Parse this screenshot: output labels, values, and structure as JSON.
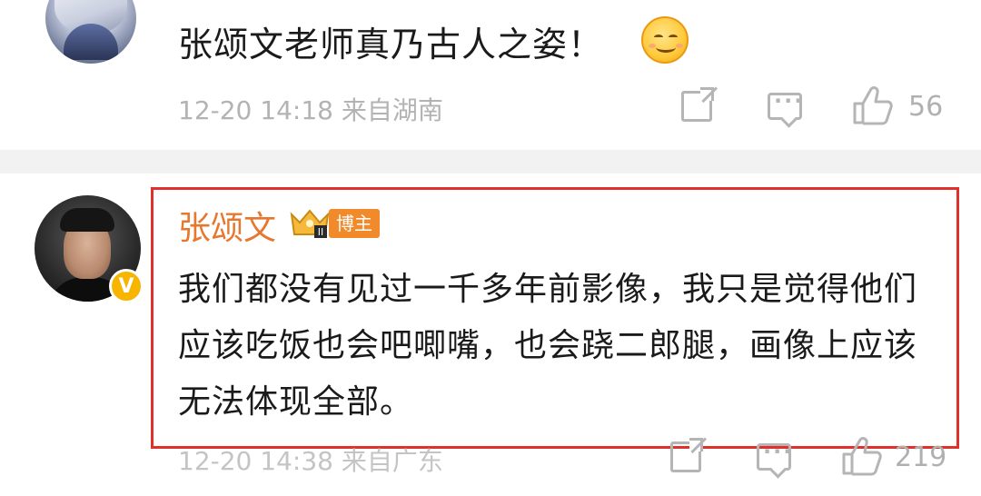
{
  "comment1": {
    "text": "张颂文老师真乃古人之姿！",
    "emoji": "smiley-emoji",
    "meta": "12-20 14:18 来自湖南",
    "likes": "56"
  },
  "comment2": {
    "username": "张颂文",
    "badge": "博主",
    "verified_badge": "V",
    "text": "我们都没有见过一千多年前影像，我只是觉得他们应该吃饭也会吧唧嘴，也会跷二郎腿，画像上应该无法体现全部。",
    "meta": "12-20 14:38 来自广东",
    "likes": "219"
  },
  "colors": {
    "username": "#e8772e",
    "highlight_border": "#e0302c",
    "badge_bg": "#f08a2a",
    "meta_text": "#b3b3b3"
  },
  "icons": [
    "share-icon",
    "comment-icon",
    "like-icon",
    "crown-icon"
  ]
}
